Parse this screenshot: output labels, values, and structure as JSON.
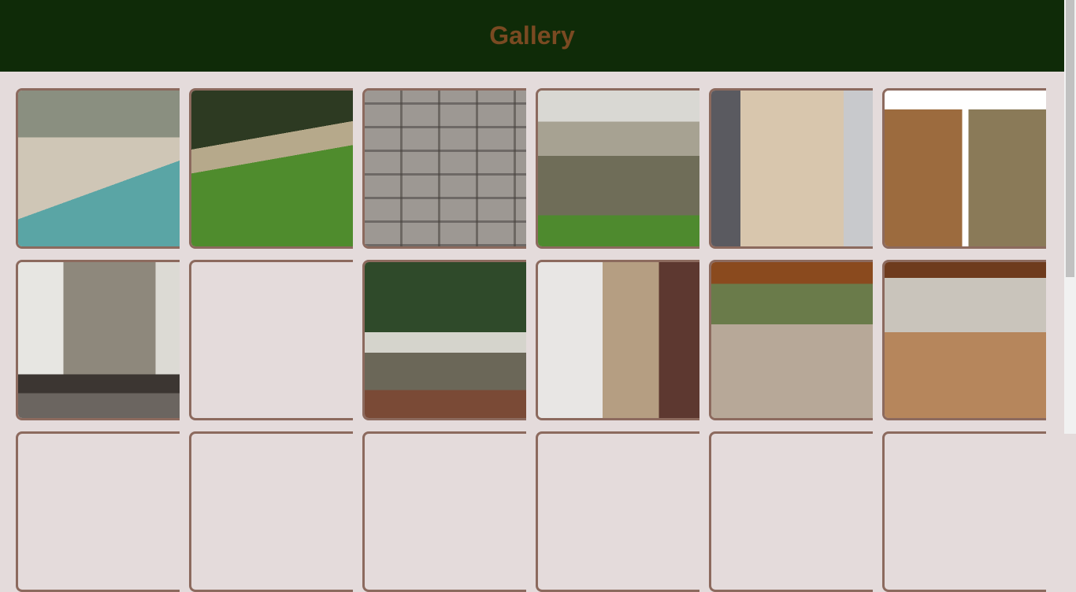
{
  "header": {
    "title": "Gallery"
  },
  "gallery": {
    "items": [
      {
        "name": "pool-paving"
      },
      {
        "name": "lawn-garden-wall"
      },
      {
        "name": "rock-wall-closeup"
      },
      {
        "name": "stacked-stone-ledge"
      },
      {
        "name": "stone-cladding-chimney"
      },
      {
        "name": "cladding-collage"
      },
      {
        "name": "stone-fireplace"
      },
      {
        "name": "empty-placeholder"
      },
      {
        "name": "garden-balustrade"
      },
      {
        "name": "stone-wall-corner"
      },
      {
        "name": "patio-bar-1"
      },
      {
        "name": "patio-bar-2"
      }
    ]
  },
  "colors": {
    "header_bg": "#0f2b08",
    "title": "#7a4a22",
    "page_bg": "#e4dbdb",
    "tile_border": "#8c6a5e"
  }
}
